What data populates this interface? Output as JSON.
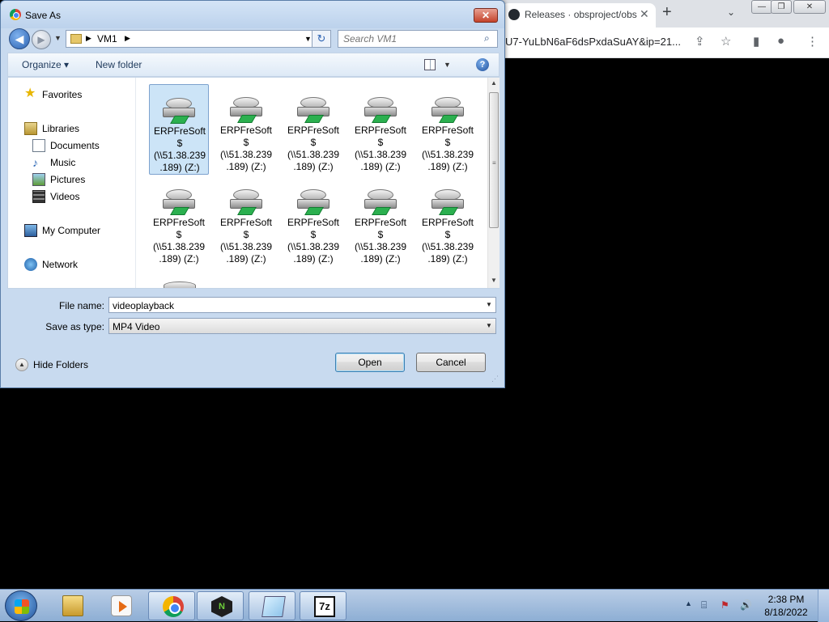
{
  "browser": {
    "tab_title": "Releases · obsproject/obs",
    "tab_close": "✕",
    "new_tab": "+",
    "tab_search": "⌄",
    "url": "U7-YuLbN6aF6dsPxdaSuAY&ip=21...",
    "win_min": "—",
    "win_max": "❐",
    "win_close": "✕",
    "share": "⇪",
    "bookmark": "☆",
    "sidepanel": "▮",
    "profile": "●",
    "menu": "⋮"
  },
  "dialog": {
    "title": "Save As",
    "close": "✕",
    "back": "◀",
    "forward": "▶",
    "breadcrumb": "VM1",
    "search_placeholder": "Search VM1",
    "search_icon": "⌕",
    "refresh": "↻",
    "organize": "Organize ▾",
    "new_folder": "New folder",
    "help": "?",
    "navpane": {
      "favorites": "Favorites",
      "libraries": "Libraries",
      "documents": "Documents",
      "music": "Music",
      "pictures": "Pictures",
      "videos": "Videos",
      "my_computer": "My Computer",
      "network": "Network"
    },
    "files": [
      {
        "name": "ERPFreSoft\n$\n(\\\\51.38.239\n.189) (Z:)",
        "selected": true
      },
      {
        "name": "ERPFreSoft\n$\n(\\\\51.38.239\n.189) (Z:)",
        "selected": false
      },
      {
        "name": "ERPFreSoft\n$\n(\\\\51.38.239\n.189) (Z:)",
        "selected": false
      },
      {
        "name": "ERPFreSoft\n$\n(\\\\51.38.239\n.189) (Z:)",
        "selected": false
      },
      {
        "name": "ERPFreSoft\n$\n(\\\\51.38.239\n.189) (Z:)",
        "selected": false
      },
      {
        "name": "ERPFreSoft\n$\n(\\\\51.38.239\n.189) (Z:)",
        "selected": false
      },
      {
        "name": "ERPFreSoft\n$\n(\\\\51.38.239\n.189) (Z:)",
        "selected": false
      },
      {
        "name": "ERPFreSoft\n$\n(\\\\51.38.239\n.189) (Z:)",
        "selected": false
      },
      {
        "name": "ERPFreSoft\n$\n(\\\\51.38.239\n.189) (Z:)",
        "selected": false
      },
      {
        "name": "ERPFreSoft\n$\n(\\\\51.38.239\n.189) (Z:)",
        "selected": false
      }
    ],
    "file_name_label": "File name:",
    "file_name_value": "videoplayback",
    "save_type_label": "Save as type:",
    "save_type_value": "MP4 Video",
    "hide_folders": "Hide Folders",
    "open_button": "Open",
    "cancel_button": "Cancel"
  },
  "taskbar": {
    "node_label": "N",
    "sevenzip_label": "7z",
    "tray_arrow": "▲",
    "tray_volume": "🔊",
    "time": "2:38 PM",
    "date": "8/18/2022"
  },
  "icons": {
    "drive_icon": "network-drive-icon",
    "folder_icon": "folder-icon",
    "start_icon": "windows-start-icon"
  },
  "colors": {
    "selection": "#cce4f7",
    "titlebar": "#c8daef",
    "close_button": "#c4432b"
  }
}
